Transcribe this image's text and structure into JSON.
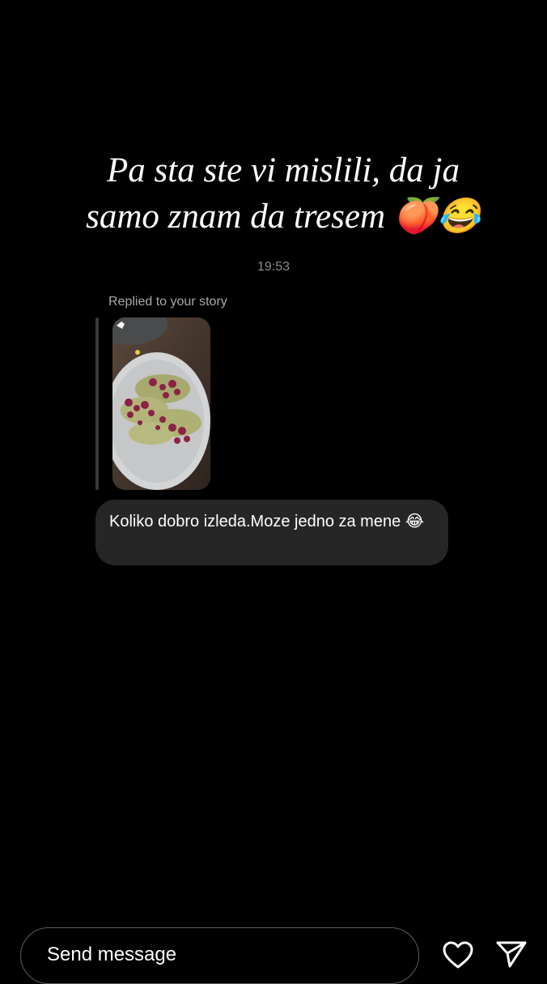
{
  "story": {
    "caption_line1": "Pa sta ste vi mislili, da ja",
    "caption_line2": "samo znam da tresem 🍑😂"
  },
  "thread": {
    "timestamp": "19:53",
    "reply_label": "Replied to your story",
    "story_thumbnail_icon": "food-photo-thumbnail",
    "message_text": "Koliko dobro izleda.Moze jedno za mene 😂"
  },
  "composer": {
    "placeholder": "Send message",
    "like_icon": "heart-icon",
    "send_icon": "send-icon"
  },
  "colors": {
    "background": "#000000",
    "bubble": "#262626",
    "muted_text": "#a8a8a8",
    "composer_border": "#5c5c5c"
  }
}
